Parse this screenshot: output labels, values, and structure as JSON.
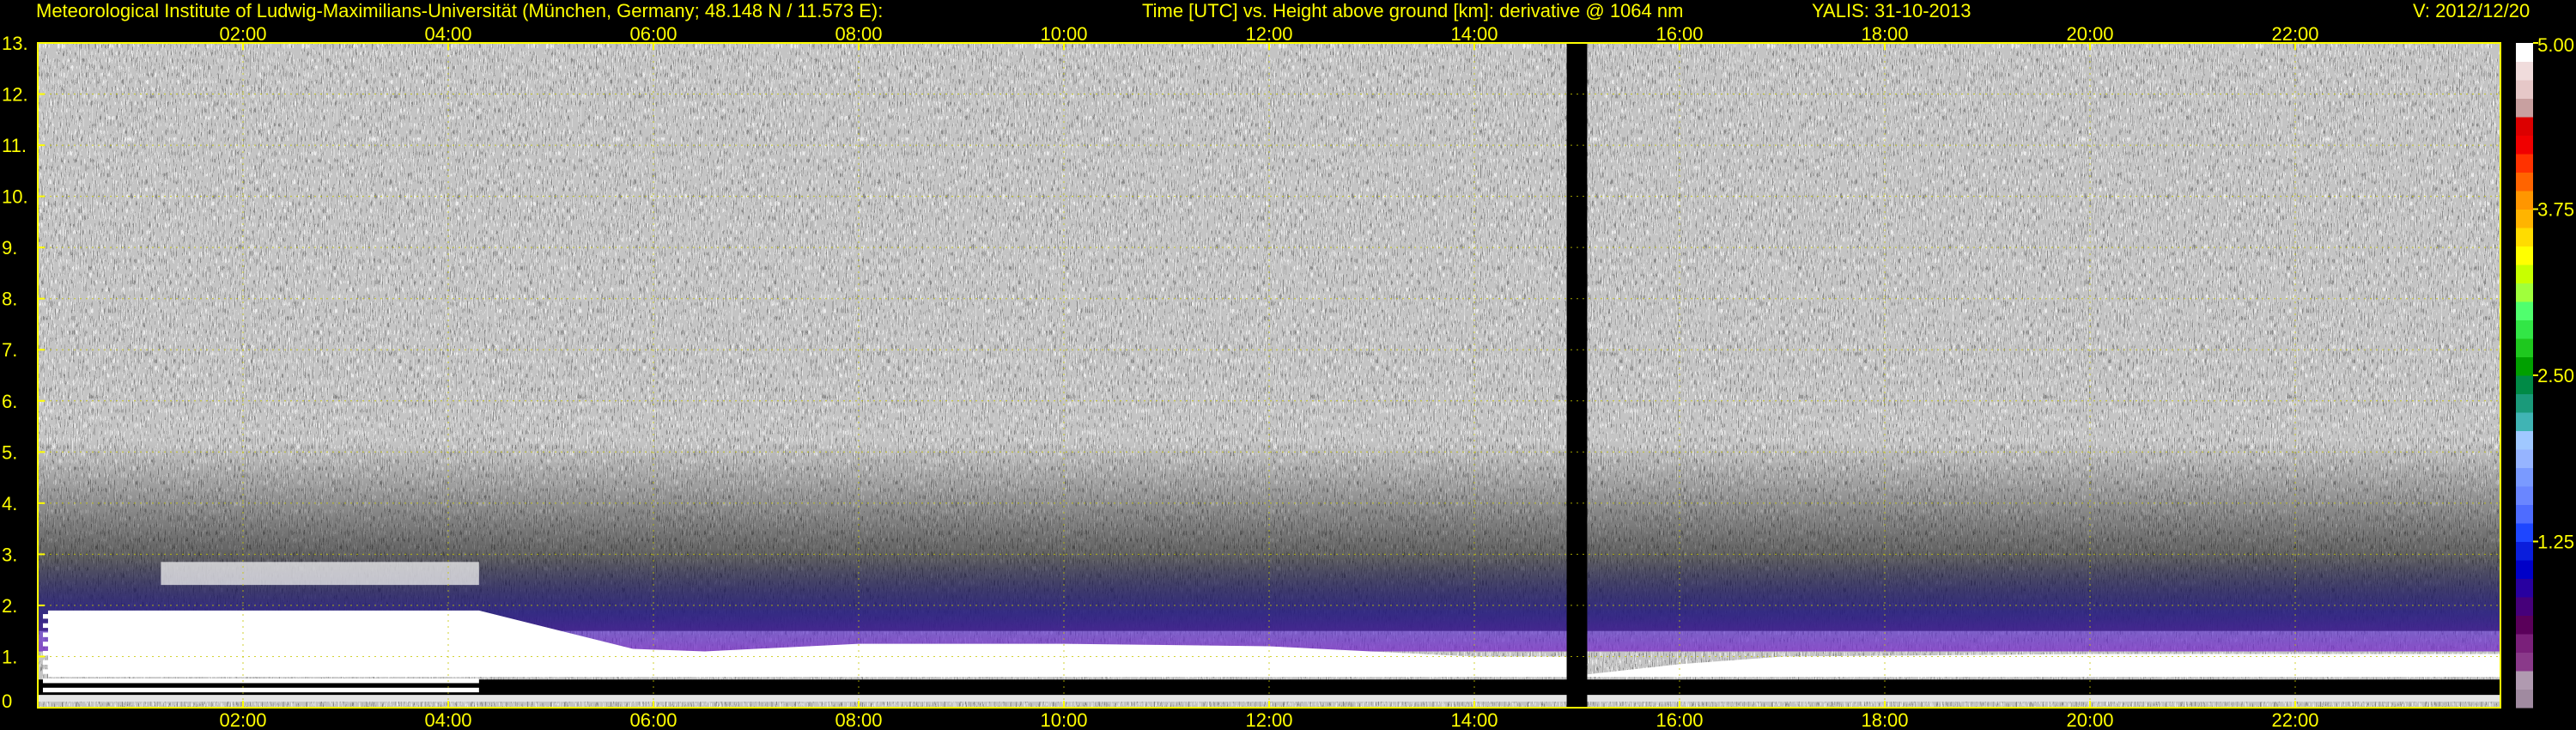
{
  "header": {
    "institution": "Meteorological Institute of Ludwig-Maximilians-Universität (München, Germany; 48.148 N / 11.573 E):",
    "title": "Time [UTC] vs. Height above ground [km]: derivative @ 1064 nm",
    "instrument": "YALIS: 31-10-2013",
    "version": "V: 2012/12/20"
  },
  "chart_data": {
    "type": "heatmap",
    "xlabel": "Time [UTC]",
    "ylabel": "Height above ground [km]",
    "x_range_hours": [
      0,
      24
    ],
    "ylim": [
      0,
      13
    ],
    "x_tick_hours": [
      2,
      4,
      6,
      8,
      10,
      12,
      14,
      16,
      18,
      20,
      22
    ],
    "x_tick_labels": [
      "02:00",
      "04:00",
      "06:00",
      "08:00",
      "10:00",
      "12:00",
      "14:00",
      "16:00",
      "18:00",
      "20:00",
      "22:00"
    ],
    "y_ticks": [
      0,
      1,
      2,
      3,
      4,
      5,
      6,
      7,
      8,
      9,
      10,
      11,
      12,
      13
    ],
    "y_tick_labels": [
      "0",
      "1.",
      "2.",
      "3.",
      "4.",
      "5.",
      "6.",
      "7.",
      "8.",
      "9.",
      "10.",
      "11.",
      "12.",
      "13."
    ],
    "grid": true,
    "colorbar": {
      "min": 0,
      "max": 5,
      "ticks": [
        1.25,
        2.5,
        3.75,
        5.0
      ],
      "tick_labels": [
        "1.25",
        "2.50",
        "3.75",
        "5.00"
      ],
      "colors": [
        "#a08aa0",
        "#b09ab0",
        "#8a3a8a",
        "#7a207a",
        "#5a005a",
        "#46007a",
        "#2800a0",
        "#0000c8",
        "#0a1edc",
        "#1e46ff",
        "#4e6cff",
        "#6a86ff",
        "#7a9aff",
        "#96b4ff",
        "#a0c8ff",
        "#40b4b4",
        "#1a9a7a",
        "#008a46",
        "#00a000",
        "#1ec81e",
        "#32e646",
        "#50ff6e",
        "#a0ff3c",
        "#c8ff00",
        "#ffff00",
        "#ffdc00",
        "#ffb400",
        "#ff9600",
        "#ff6400",
        "#ff3200",
        "#f00000",
        "#dc0000",
        "#c8a0a0",
        "#e6c8c8",
        "#f0dcdc",
        "#ffffff"
      ]
    },
    "data_gap_hours": [
      14.9,
      15.1
    ],
    "cloud_top_km": [
      {
        "hours": 0.1,
        "km": 1.9
      },
      {
        "hours": 4.3,
        "km": 1.9
      },
      {
        "hours": 5.8,
        "km": 1.15
      },
      {
        "hours": 6.5,
        "km": 1.1
      },
      {
        "hours": 8.0,
        "km": 1.25
      },
      {
        "hours": 10.0,
        "km": 1.25
      },
      {
        "hours": 12.0,
        "km": 1.2
      },
      {
        "hours": 14.0,
        "km": 1.0
      },
      {
        "hours": 14.9,
        "km": 1.0
      },
      {
        "hours": 15.1,
        "km": 0.65
      },
      {
        "hours": 16.0,
        "km": 0.85
      },
      {
        "hours": 17.0,
        "km": 1.0
      },
      {
        "hours": 20.0,
        "km": 1.05
      },
      {
        "hours": 24.0,
        "km": 1.05
      }
    ],
    "elevated_layer": {
      "hours": [
        1.2,
        4.3
      ],
      "km": [
        2.4,
        2.85
      ]
    }
  }
}
